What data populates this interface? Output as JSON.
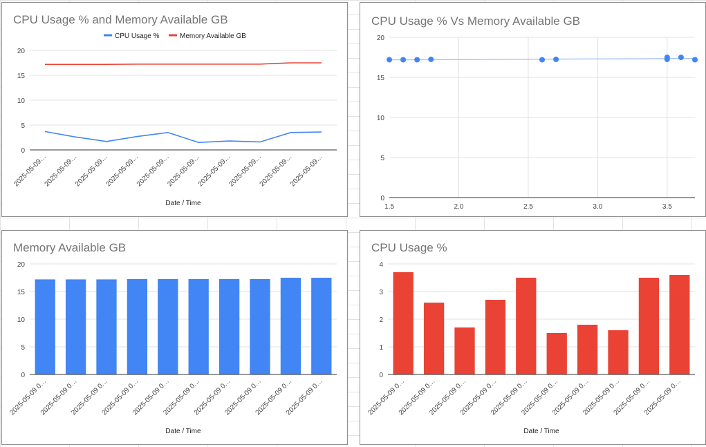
{
  "colors": {
    "cpu": "#4285f4",
    "memory": "#ea4335",
    "scatter_trend": "#a4c2f4"
  },
  "chart_data": [
    {
      "id": "combo",
      "type": "line",
      "title": "CPU Usage % and Memory Available GB",
      "xlabel": "Date / Time",
      "ylabel": "",
      "categories": [
        "2025-05-09…",
        "2025-05-09…",
        "2025-05-09…",
        "2025-05-09…",
        "2025-05-09…",
        "2025-05-09…",
        "2025-05-09…",
        "2025-05-09…",
        "2025-05-09…",
        "2025-05-09…"
      ],
      "series": [
        {
          "name": "CPU Usage %",
          "color": "#4285f4",
          "values": [
            3.7,
            2.6,
            1.7,
            2.7,
            3.5,
            1.5,
            1.8,
            1.6,
            3.5,
            3.6
          ]
        },
        {
          "name": "Memory Available GB",
          "color": "#ea4335",
          "values": [
            17.2,
            17.2,
            17.2,
            17.25,
            17.25,
            17.25,
            17.25,
            17.25,
            17.5,
            17.5
          ]
        }
      ],
      "ylim": [
        0,
        20
      ],
      "yticks": [
        "0",
        "5",
        "10",
        "15",
        "20"
      ],
      "grid": true,
      "legend": "top"
    },
    {
      "id": "scatter",
      "type": "scatter",
      "title": "CPU Usage % Vs Memory Available GB",
      "xlabel": "",
      "ylabel": "",
      "points": [
        {
          "x": 1.5,
          "y": 17.2
        },
        {
          "x": 1.6,
          "y": 17.2
        },
        {
          "x": 1.7,
          "y": 17.2
        },
        {
          "x": 1.8,
          "y": 17.25
        },
        {
          "x": 2.6,
          "y": 17.2
        },
        {
          "x": 2.7,
          "y": 17.25
        },
        {
          "x": 3.5,
          "y": 17.25
        },
        {
          "x": 3.5,
          "y": 17.5
        },
        {
          "x": 3.6,
          "y": 17.5
        },
        {
          "x": 3.7,
          "y": 17.2
        }
      ],
      "trendline": true,
      "xlim": [
        1.5,
        3.7
      ],
      "ylim": [
        0,
        20
      ],
      "xticks": [
        "1.5",
        "2.0",
        "2.5",
        "3.0",
        "3.5"
      ],
      "yticks": [
        "0",
        "5",
        "10",
        "15",
        "20"
      ],
      "grid": true
    },
    {
      "id": "memory_bar",
      "type": "bar",
      "title": "Memory Available GB",
      "xlabel": "Date / Time",
      "ylabel": "",
      "categories": [
        "2025-05-09 0…",
        "2025-05-09 0…",
        "2025-05-09 0…",
        "2025-05-09 0…",
        "2025-05-09 0…",
        "2025-05-09 0…",
        "2025-05-09 0…",
        "2025-05-09 0…",
        "2025-05-09 0…",
        "2025-05-09 0…"
      ],
      "values": [
        17.2,
        17.2,
        17.2,
        17.25,
        17.25,
        17.25,
        17.25,
        17.25,
        17.5,
        17.5
      ],
      "color": "#4285f4",
      "ylim": [
        0,
        20
      ],
      "yticks": [
        "0",
        "5",
        "10",
        "15",
        "20"
      ],
      "grid": true
    },
    {
      "id": "cpu_bar",
      "type": "bar",
      "title": "CPU Usage %",
      "xlabel": "Date / Time",
      "ylabel": "",
      "categories": [
        "2025-05-09 0…",
        "2025-05-09 0…",
        "2025-05-09 0…",
        "2025-05-09 0…",
        "2025-05-09 0…",
        "2025-05-09 0…",
        "2025-05-09 0…",
        "2025-05-09 0…",
        "2025-05-09 0…",
        "2025-05-09 0…"
      ],
      "values": [
        3.7,
        2.6,
        1.7,
        2.7,
        3.5,
        1.5,
        1.8,
        1.6,
        3.5,
        3.6
      ],
      "color": "#ea4335",
      "ylim": [
        0,
        4
      ],
      "yticks": [
        "0",
        "1",
        "2",
        "3",
        "4"
      ],
      "grid": true
    }
  ]
}
